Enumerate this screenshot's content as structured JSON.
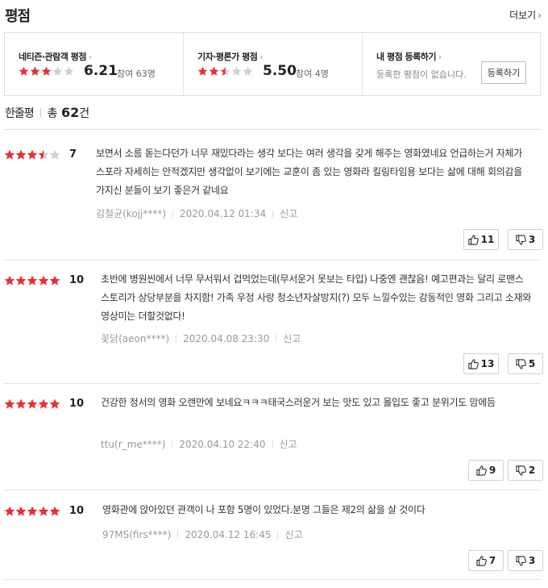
{
  "header": {
    "title": "평점",
    "more_label": "더보기"
  },
  "summary": {
    "netizen": {
      "label": "네티즌·관람객 평점",
      "score": "6.21",
      "count": "참여 63명",
      "rating": 3
    },
    "critic": {
      "label": "기자·평론가 평점",
      "score": "5.50",
      "count": "참여 4명",
      "rating": 2.5
    },
    "mine": {
      "label": "내 평점 등록하기",
      "message": "등록한 평점이 없습니다.",
      "register_label": "등록하기"
    }
  },
  "oneline": {
    "title": "한줄평",
    "total_prefix": "총",
    "total": "62",
    "total_suffix": "건"
  },
  "reviews": [
    {
      "rating": 3.5,
      "score": "7",
      "text": "보면서 소름 돋는다던가 너무 재밌다라는 생각 보다는 여러 생각을 갖게 해주는 영화였네요 언급하는거 자체가 스포라 자세히는 안적겠지만 생각없이 보기에는 교훈이 좀 있는 영화라 킬링타임용 보다는 삶에 대해 회의감을 가지신 분들이 보기 좋은거 같네요",
      "author": "김철균(kojj****)",
      "date": "2020.04.12 01:34",
      "report": "신고",
      "likes": "11",
      "dislikes": "3"
    },
    {
      "rating": 5,
      "score": "10",
      "text": "초반에 병원씬에서 너무 무서워서 겁먹었는데(무서운거 못보는 타입) 나중엔 괜찮음! 예고편과는 달리 로맨스 스토리가 상당부분을 차지함! 가족 우정 사랑 청소년자살방지(?) 모두 느낄수있는 감동적인 영화 그리고 소재와 영상미는 더할것없다!",
      "author": "꽃닭(aeon****)",
      "date": "2020.04.08 23:30",
      "report": "신고",
      "likes": "13",
      "dislikes": "5"
    },
    {
      "rating": 5,
      "score": "10",
      "text": "건강한 정서의 영화 오랜만에 보네요ㅋㅋㅋ태국스러운거 보는 맛도 있고 몰입도 좋고 분위기도 맘에듬",
      "author": "ttu(r_me****)",
      "date": "2020.04.10 22:40",
      "report": "신고",
      "likes": "9",
      "dislikes": "2"
    },
    {
      "rating": 5,
      "score": "10",
      "text": "영화관에 앉아있던 관객이 나 포함 5명이 있었다.분명 그들은 제2의 삶을 살 것이다",
      "author": "97MS(firs****)",
      "date": "2020.04.12 16:45",
      "report": "신고",
      "likes": "7",
      "dislikes": "3"
    }
  ],
  "colors": {
    "star_on": "#e5323a",
    "star_off": "#d0d0d0",
    "accent": "#e5323a"
  }
}
